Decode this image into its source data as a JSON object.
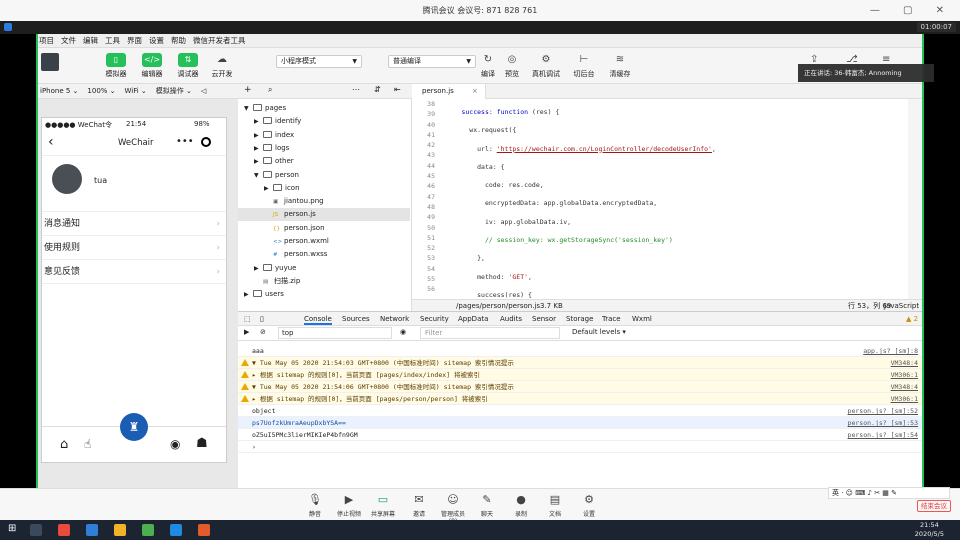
{
  "meeting": {
    "title": "腾讯会议 会议号: 871 828 761",
    "timer": "01:00:07",
    "notice": "正在讲话: 36-韩富杰; Annoming",
    "buttons": [
      "静音",
      "停止视频",
      "共享屏幕",
      "邀请",
      "管理成员(8)",
      "聊天",
      "录制",
      "文档",
      "设置"
    ],
    "leave": "结束会议",
    "ime": "英 · ☺ ⌨ ♪ ✂ ▦ ✎"
  },
  "menu": [
    "项目",
    "文件",
    "编辑",
    "工具",
    "界面",
    "设置",
    "帮助",
    "微信开发者工具"
  ],
  "toolbar": {
    "buttons": [
      "模拟器",
      "编辑器",
      "调试器",
      "云开发"
    ],
    "mode": "小程序模式",
    "compile": "普通编译",
    "right": [
      "编译",
      "预览",
      "真机调试",
      "切后台",
      "清缓存"
    ]
  },
  "simbar": [
    "iPhone 5 ⌄",
    "100% ⌄",
    "WiFi ⌄",
    "模拟操作 ⌄",
    "◁"
  ],
  "phone": {
    "carrier": "●●●●● WeChat令",
    "time": "21:54",
    "battery": "98%",
    "title": "WeChair",
    "dots": "•••",
    "nickname": "tua",
    "items": [
      "消息通知",
      "使用规则",
      "意见反馈"
    ]
  },
  "tree": [
    {
      "name": "pages",
      "lvl": 0,
      "type": "open"
    },
    {
      "name": "identify",
      "lvl": 1,
      "type": "closed"
    },
    {
      "name": "index",
      "lvl": 1,
      "type": "closed"
    },
    {
      "name": "logs",
      "lvl": 1,
      "type": "closed"
    },
    {
      "name": "other",
      "lvl": 1,
      "type": "closed"
    },
    {
      "name": "person",
      "lvl": 1,
      "type": "open"
    },
    {
      "name": "icon",
      "lvl": 2,
      "type": "closed"
    },
    {
      "name": "jiantou.png",
      "lvl": 2,
      "type": "img"
    },
    {
      "name": "person.js",
      "lvl": 2,
      "type": "js",
      "sel": true
    },
    {
      "name": "person.json",
      "lvl": 2,
      "type": "json"
    },
    {
      "name": "person.wxml",
      "lvl": 2,
      "type": "wxml"
    },
    {
      "name": "person.wxss",
      "lvl": 2,
      "type": "wxss"
    },
    {
      "name": "yuyue",
      "lvl": 1,
      "type": "closed"
    },
    {
      "name": "扫描.zip",
      "lvl": 1,
      "type": "zip"
    },
    {
      "name": "users",
      "lvl": 0,
      "type": "closed"
    }
  ],
  "editor": {
    "tab": "person.js",
    "lines": [
      38,
      39,
      40,
      41,
      42,
      43,
      44,
      45,
      46,
      47,
      48,
      49,
      50,
      51,
      52,
      53,
      54,
      55,
      56
    ],
    "path": "/pages/person/person.js",
    "size": "3.7 KB",
    "pos": "行 53，列 69",
    "lang": "JavaScript"
  },
  "console": {
    "tabs": [
      "Console",
      "Sources",
      "Network",
      "Security",
      "AppData",
      "Audits",
      "Sensor",
      "Storage",
      "Trace",
      "Wxml"
    ],
    "context": "top",
    "filter": "Filter",
    "levels": "Default levels ▾",
    "warnCount": "▲ 2",
    "rows": [
      {
        "t": "aaa",
        "src": "app.js? [sm]:8",
        "k": ""
      },
      {
        "t": "▼ Tue May 05 2020 21:54:03 GMT+0800 (中国标准时间) sitemap 索引情况提示",
        "src": "VM348:4",
        "k": "warn"
      },
      {
        "t": "  ▸ 根据 sitemap 的规则[0]，当前页面 [pages/index/index] 将被索引",
        "src": "VM306:1",
        "k": "warn"
      },
      {
        "t": "▼ Tue May 05 2020 21:54:06 GMT+0800 (中国标准时间) sitemap 索引情况提示",
        "src": "VM348:4",
        "k": "warn"
      },
      {
        "t": "  ▸ 根据 sitemap 的规则[0]，当前页面 [pages/person/person] 将被索引",
        "src": "VM306:1",
        "k": "warn"
      },
      {
        "t": "object",
        "src": "person.js? [sm]:52",
        "k": ""
      },
      {
        "t": "ps7UofzkUmraAeupDxbYSA==",
        "src": "person.js? [sm]:53",
        "k": "hl"
      },
      {
        "t": "oZ5uI5PMc3lierMIKIeP4bfn9GM",
        "src": "person.js? [sm]:54",
        "k": ""
      },
      {
        "t": "›",
        "src": "",
        "k": ""
      }
    ]
  },
  "taskbar": {
    "time": "21:54",
    "date": "2020/5/5"
  }
}
